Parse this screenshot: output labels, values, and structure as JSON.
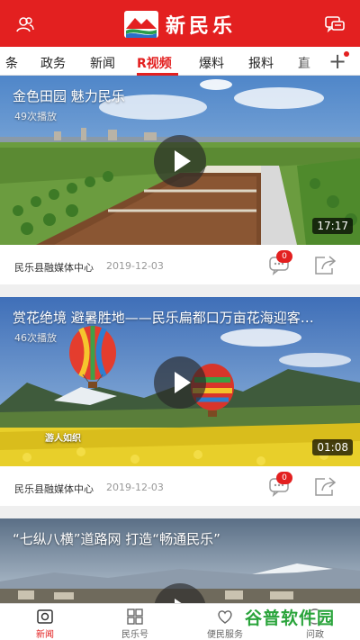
{
  "header": {
    "logo_text": "新民乐",
    "left_icon": "user-icon",
    "right_icon": "message-icon"
  },
  "tabs": [
    {
      "label": "条",
      "active": false
    },
    {
      "label": "政务",
      "active": false
    },
    {
      "label": "新闻",
      "active": false
    },
    {
      "label": "R视频",
      "active": true
    },
    {
      "label": "爆料",
      "active": false
    },
    {
      "label": "报料",
      "active": false
    },
    {
      "label": "直",
      "active": false
    }
  ],
  "tab_add": "+",
  "videos": [
    {
      "title": "金色田园 魅力民乐",
      "plays": "49次播放",
      "duration": "17:17",
      "source": "民乐县融媒体中心",
      "date": "2019-12-03",
      "comments": "0"
    },
    {
      "title": "赏花绝境 避暑胜地——民乐扁都口万亩花海迎客…",
      "plays": "46次播放",
      "duration": "01:08",
      "source": "民乐县融媒体中心",
      "date": "2019-12-03",
      "comments": "0",
      "overlay_tag": "游人如织"
    },
    {
      "title": "“七纵八横”道路网 打造“畅通民乐”"
    }
  ],
  "bottom_nav": [
    {
      "label": "新闻",
      "icon": "news-icon",
      "active": true
    },
    {
      "label": "民乐号",
      "icon": "grid-icon",
      "active": false
    },
    {
      "label": "便民服务",
      "icon": "heart-icon",
      "active": false
    },
    {
      "label": "问政",
      "icon": "question-icon",
      "active": false
    }
  ],
  "watermark": "谷普软件园",
  "colors": {
    "brand_red": "#e32020",
    "watermark_green": "#2aa43b"
  }
}
